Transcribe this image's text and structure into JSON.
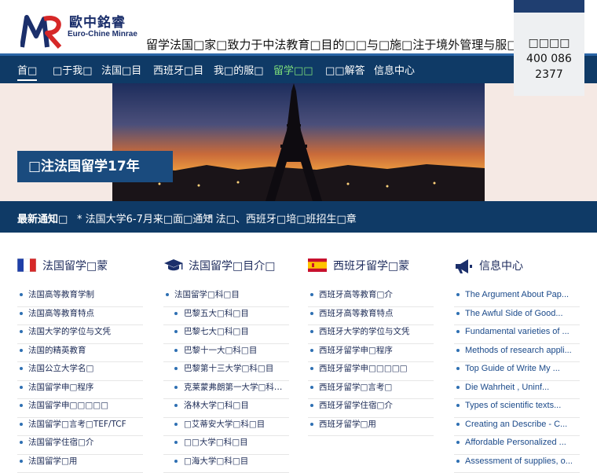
{
  "header": {
    "logo_cn": "歐中銘睿",
    "logo_en": "Euro-Chine Minrae",
    "slogan": "留学法国□家□致力于中法教育□目的□□与□施□注于境外管理与服□",
    "hotline_label": "□□□□",
    "hotline_number": "400 086 2377"
  },
  "nav": {
    "items": [
      "首□",
      "□于我□",
      "法国□目",
      "西班牙□目",
      "我□的服□",
      "留学□□",
      "□□解答",
      "信息中心"
    ]
  },
  "banner": {
    "caption": "□注法国留学17年"
  },
  "notice": {
    "title": "最新通知□",
    "items": [
      "* 法国大学6-7月来□面□通知",
      "* 法□、西班牙□培□班招生□章"
    ]
  },
  "columns": [
    {
      "title": "法国留学□蒙",
      "icon": "france-flag-icon",
      "items": [
        "法国高等教育学制",
        "法国高等教育特点",
        "法国大学的学位与文凭",
        "法国的精英教育",
        "法国公立大学名□",
        "法国留学申□程序",
        "法国留学申□□□□□",
        "法国留学□言考□TEF/TCF",
        "法国留学住宿□介",
        "法国留学□用"
      ]
    },
    {
      "title": "法国留学□目介□",
      "icon": "graduation-cap-icon",
      "items": [
        "法国留学□科□目",
        "巴黎五大□科□目",
        "巴黎七大□科□目",
        "巴黎十一大□科□目",
        "巴黎第十三大学□科□目",
        "克莱蒙弗朗第一大学□科□目",
        "洛林大学□科□目",
        "□艾蒂安大学□科□目",
        "□□大学□科□目",
        "□海大学□科□目"
      ]
    },
    {
      "title": "西班牙留学□蒙",
      "icon": "spain-flag-icon",
      "items": [
        "西班牙高等教育□介",
        "西班牙高等教育特点",
        "西班牙大学的学位与文凭",
        "西班牙留学申□程序",
        "西班牙留学申□□□□□",
        "西班牙留学□言考□",
        "西班牙留学住宿□介",
        "西班牙留学□用"
      ]
    },
    {
      "title": "信息中心",
      "icon": "megaphone-icon",
      "items": [
        "The Argument About Pap...",
        "The Awful Side of Good...",
        "Fundamental varieties of ...",
        "Methods of research appli...",
        "Top Guide of Write My ...",
        "Die Wahrheit , Uninf...",
        "Types of scientific texts...",
        "Creating an Describe - C...",
        "Affordable Personalized ...",
        "Assessment of supplies, o..."
      ]
    }
  ],
  "colors": {
    "nav_bg": "#0f3a66",
    "accent_green": "#7fe07a",
    "caption_bg": "#1a4b7e",
    "link_dark": "#1b2a55"
  }
}
